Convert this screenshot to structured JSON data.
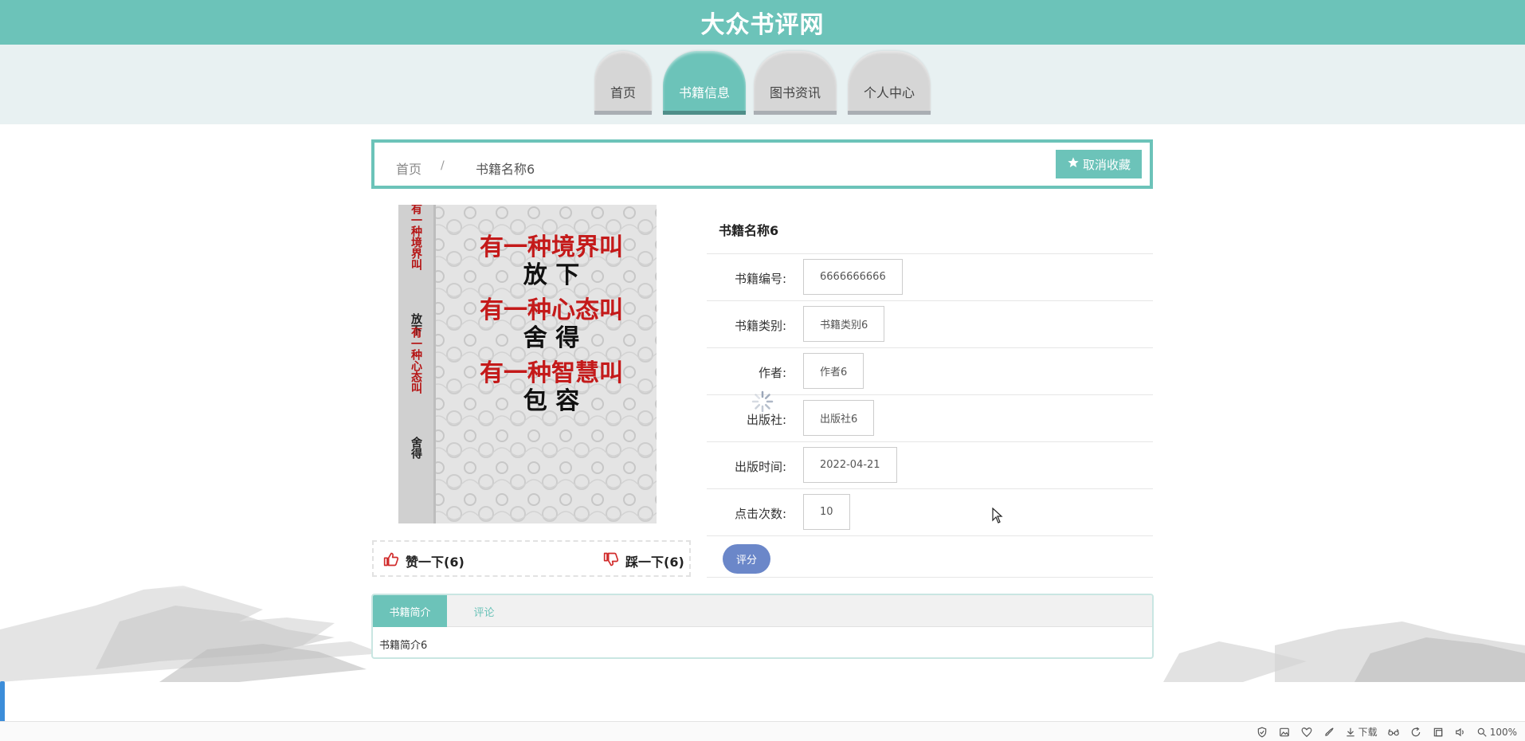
{
  "header": {
    "title": "大众书评网"
  },
  "nav": {
    "items": [
      "首页",
      "书籍信息",
      "图书资讯",
      "个人中心"
    ],
    "active_index": 1
  },
  "breadcrumb": {
    "home": "首页",
    "separator": "/",
    "current": "书籍名称6"
  },
  "favorite_button": {
    "label": "取消收藏",
    "icon": "star-icon"
  },
  "cover": {
    "lines": [
      "有一种境界叫",
      "放 下",
      "有一种心态叫",
      "舍 得",
      "有一种智慧叫",
      "包 容"
    ]
  },
  "votes": {
    "like": "赞一下(6)",
    "dislike": "踩一下(6)"
  },
  "book": {
    "title": "书籍名称6",
    "fields": [
      {
        "label": "书籍编号:",
        "value": "6666666666"
      },
      {
        "label": "书籍类别:",
        "value": "书籍类别6"
      },
      {
        "label": "作者:",
        "value": "作者6"
      },
      {
        "label": "出版社:",
        "value": "出版社6"
      },
      {
        "label": "出版时间:",
        "value": "2022-04-21"
      },
      {
        "label": "点击次数:",
        "value": "10"
      }
    ],
    "rate_label": "评分"
  },
  "tabs": {
    "intro_label": "书籍简介",
    "comment_label": "评论",
    "intro_text": "书籍简介6"
  },
  "status_bar": {
    "download": "下载",
    "zoom": "100%"
  },
  "colors": {
    "accent": "#6cc3b9",
    "rate_button": "#6b87c9",
    "nav_inactive": "#d6d6d6"
  }
}
